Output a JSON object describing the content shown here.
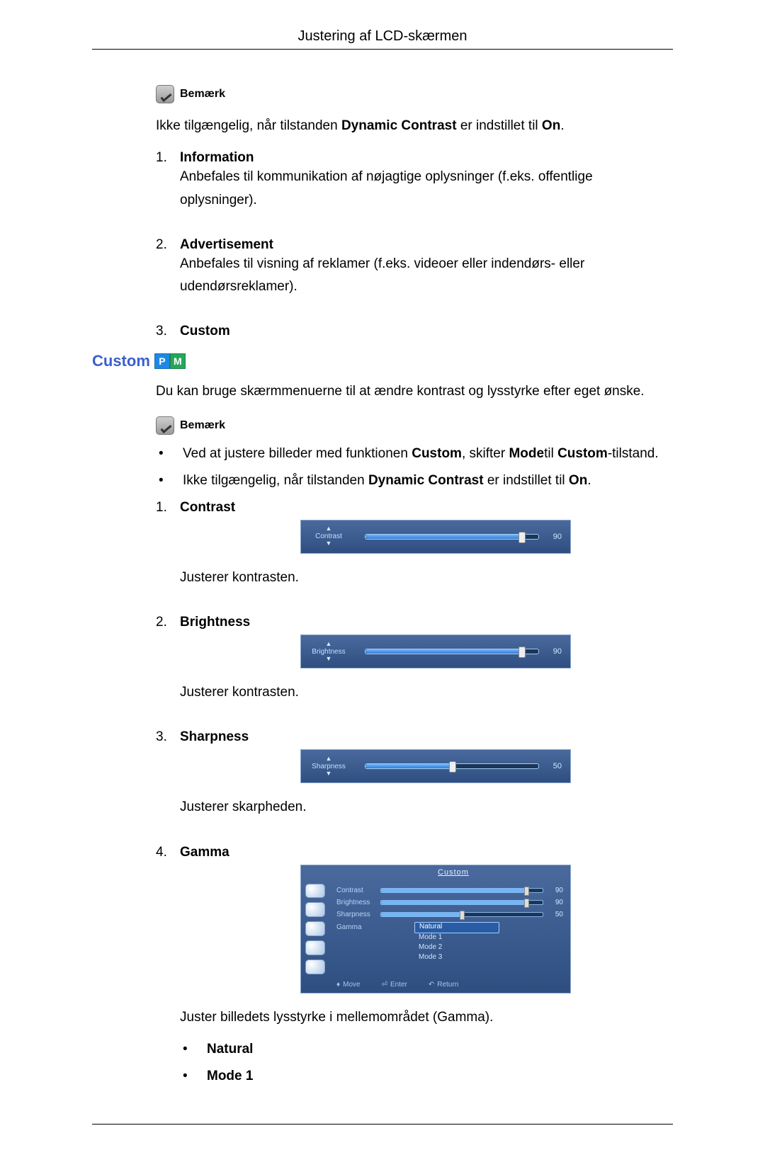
{
  "header": {
    "title": "Justering af LCD-skærmen"
  },
  "note_label": "Bemærk",
  "intro_note_pre": "Ikke tilgængelig, når tilstanden ",
  "intro_note_dc": "Dynamic Contrast",
  "intro_note_mid": " er indstillet til ",
  "intro_note_on": "On",
  "intro_note_post": ".",
  "top_list": [
    {
      "title": "Information",
      "desc": "Anbefales til kommunikation af nøjagtige oplysninger (f.eks. offentlige oplysninger)."
    },
    {
      "title": "Advertisement",
      "desc": "Anbefales til visning af reklamer (f.eks. videoer eller indendørs- eller udendørsreklamer)."
    },
    {
      "title": "Custom",
      "desc": ""
    }
  ],
  "section": {
    "title": "Custom",
    "badge_p": "P",
    "badge_m": "M"
  },
  "custom_intro": "Du kan bruge skærmmenuerne til at ændre kontrast og lysstyrke efter eget ønske.",
  "custom_bullets": {
    "b1_pre": "Ved at justere billeder med funktionen ",
    "b1_s1": "Custom",
    "b1_mid1": ", skifter ",
    "b1_s2": "Mode",
    "b1_mid2": "til ",
    "b1_s3": "Custom",
    "b1_post": "-tilstand."
  },
  "items": [
    {
      "title": "Contrast",
      "osd_label": "Contrast",
      "value": 90,
      "percent": 90,
      "desc": "Justerer kontrasten."
    },
    {
      "title": "Brightness",
      "osd_label": "Brightness",
      "value": 90,
      "percent": 90,
      "desc": "Justerer kontrasten."
    },
    {
      "title": "Sharpness",
      "osd_label": "Sharpness",
      "value": 50,
      "percent": 50,
      "desc": "Justerer skarpheden."
    },
    {
      "title": "Gamma",
      "desc": "Juster billedets lysstyrke i mellemområdet (Gamma)."
    }
  ],
  "gamma_panel": {
    "title": "Custom",
    "rows": [
      {
        "label": "Contrast",
        "value": 90,
        "percent": 90
      },
      {
        "label": "Brightness",
        "value": 90,
        "percent": 90
      },
      {
        "label": "Sharpness",
        "value": 50,
        "percent": 50
      }
    ],
    "gamma_label": "Gamma",
    "options": [
      "Natural",
      "Mode 1",
      "Mode 2",
      "Mode 3"
    ],
    "selected_index": 0,
    "footer": {
      "move": "Move",
      "enter": "Enter",
      "return": "Return"
    }
  },
  "gamma_bullets": [
    "Natural",
    "Mode 1"
  ]
}
